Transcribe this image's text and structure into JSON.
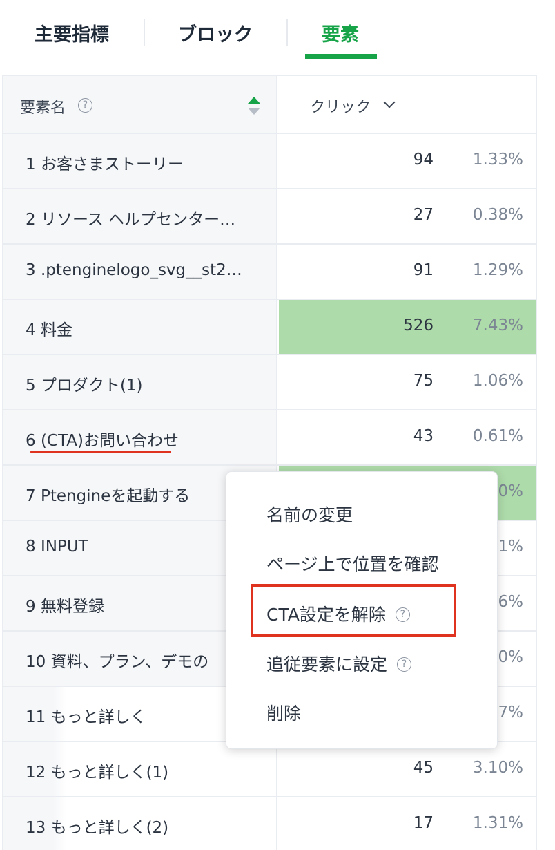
{
  "tabs": [
    {
      "label": "主要指標",
      "active": false
    },
    {
      "label": "ブロック",
      "active": false
    },
    {
      "label": "要素",
      "active": true
    }
  ],
  "colors": {
    "accent": "#17a449",
    "highlight_cell": "#aedbaa",
    "annotation": "#e0331f"
  },
  "table": {
    "col_name": "要素名",
    "col_name_help_icon": "question-circle-icon",
    "col_click": "クリック",
    "rows": [
      {
        "name": "1 お客さまストーリー",
        "clicks": "94",
        "pct": "1.33%"
      },
      {
        "name": "2 リソース ヘルプセンター…",
        "clicks": "27",
        "pct": "0.38%"
      },
      {
        "name": "3 .ptenginelogo_svg__st2…",
        "clicks": "91",
        "pct": "1.29%"
      },
      {
        "name": "4 料金",
        "clicks": "526",
        "pct": "7.43%"
      },
      {
        "name": "5 プロダクト(1)",
        "clicks": "75",
        "pct": "1.06%"
      },
      {
        "name": "6 (CTA)お問い合わせ",
        "clicks": "43",
        "pct": "0.61%"
      },
      {
        "name": "7 Ptengineを起動する",
        "clicks": "",
        "pct": "0%"
      },
      {
        "name": "8 INPUT",
        "clicks": "",
        "pct": "1%"
      },
      {
        "name": "9 無料登録",
        "clicks": "",
        "pct": "6%"
      },
      {
        "name": "10 資料、プラン、デモの",
        "clicks": "",
        "pct": "0%"
      },
      {
        "name": "11 もっと詳しく",
        "clicks": "",
        "pct": "7%"
      },
      {
        "name": "12 もっと詳しく(1)",
        "clicks": "45",
        "pct": "3.10%"
      },
      {
        "name": "13 もっと詳しく(2)",
        "clicks": "17",
        "pct": "1.31%"
      }
    ]
  },
  "context_menu": {
    "items": [
      {
        "label": "名前の変更"
      },
      {
        "label": "ページ上で位置を確認"
      },
      {
        "label": "CTA設定を解除"
      },
      {
        "label": "追従要素に設定"
      },
      {
        "label": "削除"
      }
    ]
  }
}
